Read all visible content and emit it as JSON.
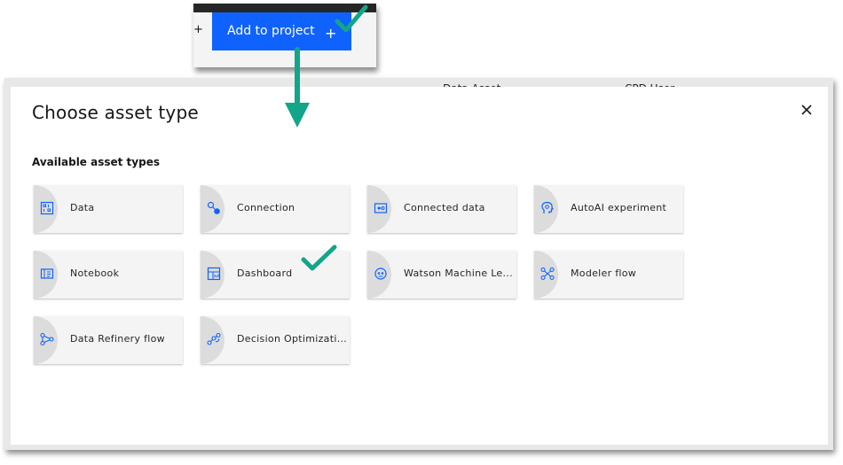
{
  "snippet": {
    "edge_glyph": "+",
    "add_button_label": "Add to project",
    "add_button_plus": "+"
  },
  "background_page": {
    "columns": [
      "Data Asset",
      "CPD User"
    ]
  },
  "modal": {
    "title": "Choose asset type",
    "section_label": "Available asset types",
    "close_glyph": "×"
  },
  "asset_types": [
    {
      "label": "Data",
      "icon": "data-icon"
    },
    {
      "label": "Connection",
      "icon": "connection-icon"
    },
    {
      "label": "Connected data",
      "icon": "connected-data-icon"
    },
    {
      "label": "AutoAI experiment",
      "icon": "autoai-icon"
    },
    {
      "label": "Notebook",
      "icon": "notebook-icon"
    },
    {
      "label": "Dashboard",
      "icon": "dashboard-icon"
    },
    {
      "label": "Watson Machine Le...",
      "icon": "watson-machine-learning-icon"
    },
    {
      "label": "Modeler flow",
      "icon": "modeler-flow-icon"
    },
    {
      "label": "Data Refinery flow",
      "icon": "data-refinery-flow-icon"
    },
    {
      "label": "Decision Optimizati...",
      "icon": "decision-optimization-icon"
    }
  ],
  "colors": {
    "primary_blue": "#0f62fe",
    "annotation_teal": "#12a58a",
    "tile_bg": "#f4f4f4",
    "tile_circle": "#dcdcdc",
    "icon_blue": "#0f62fe"
  }
}
